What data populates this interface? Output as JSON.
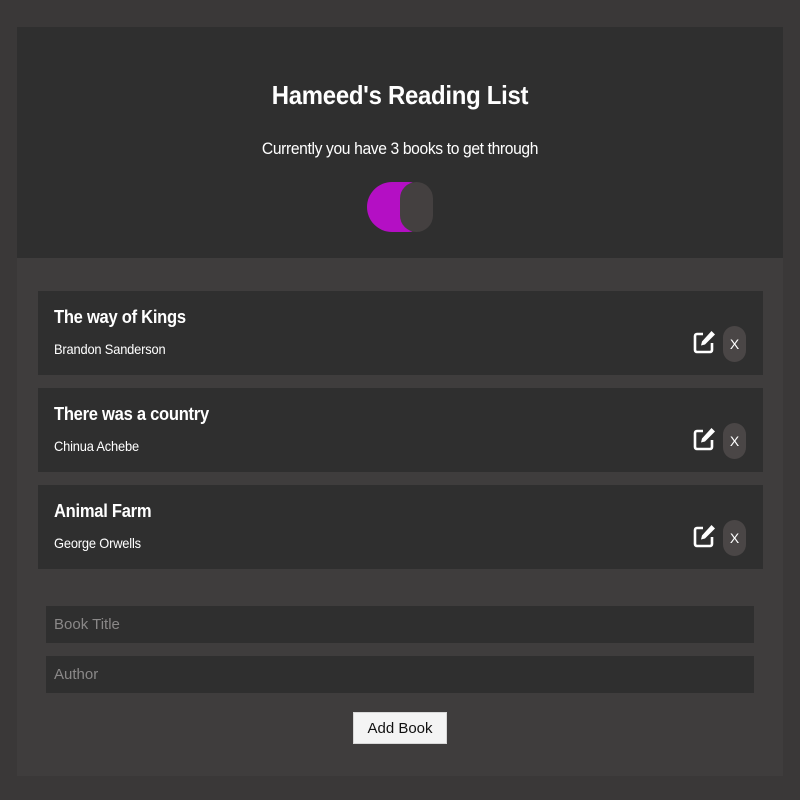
{
  "header": {
    "title": "Hameed's Reading List",
    "subtitle": "Currently you have 3 books to get through",
    "theme_toggle_color": "#b40fc4"
  },
  "books": [
    {
      "title": "The way of Kings",
      "author": "Brandon Sanderson",
      "edit_icon": "edit-icon",
      "delete_label": "X"
    },
    {
      "title": "There was a country",
      "author": "Chinua Achebe",
      "edit_icon": "edit-icon",
      "delete_label": "X"
    },
    {
      "title": "Animal Farm",
      "author": "George Orwells",
      "edit_icon": "edit-icon",
      "delete_label": "X"
    }
  ],
  "form": {
    "title_placeholder": "Book Title",
    "title_value": "",
    "author_placeholder": "Author",
    "author_value": "",
    "submit_label": "Add Book"
  },
  "colors": {
    "page_bg": "#3a3838",
    "panel_bg": "#2f2f2f",
    "accent": "#b40fc4"
  }
}
